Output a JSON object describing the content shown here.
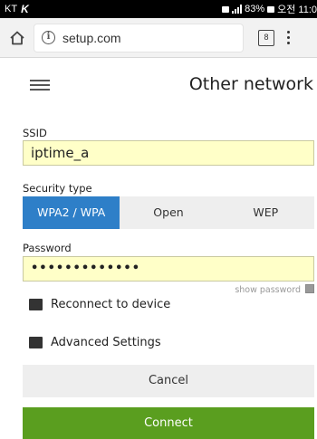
{
  "status_bar": {
    "carrier": "KT",
    "carrier_logo": "K",
    "battery": "83%",
    "time": "오전 11:0"
  },
  "browser": {
    "url": "setup.com",
    "tab_count": "8"
  },
  "header": {
    "title": "Other network"
  },
  "form": {
    "ssid_label": "SSID",
    "ssid_value": "iptime_a",
    "security_label": "Security type",
    "security_options": [
      "WPA2 / WPA",
      "Open",
      "WEP"
    ],
    "security_selected": "WPA2 / WPA",
    "password_label": "Password",
    "password_value": "•••••••••••••",
    "show_password_label": "show password",
    "reconnect_label": "Reconnect to device",
    "advanced_label": "Advanced Settings"
  },
  "buttons": {
    "cancel": "Cancel",
    "connect": "Connect"
  },
  "colors": {
    "accent_blue": "#2e7fc8",
    "connect_green": "#5a9e1f",
    "field_yellow": "#ffffc8"
  }
}
